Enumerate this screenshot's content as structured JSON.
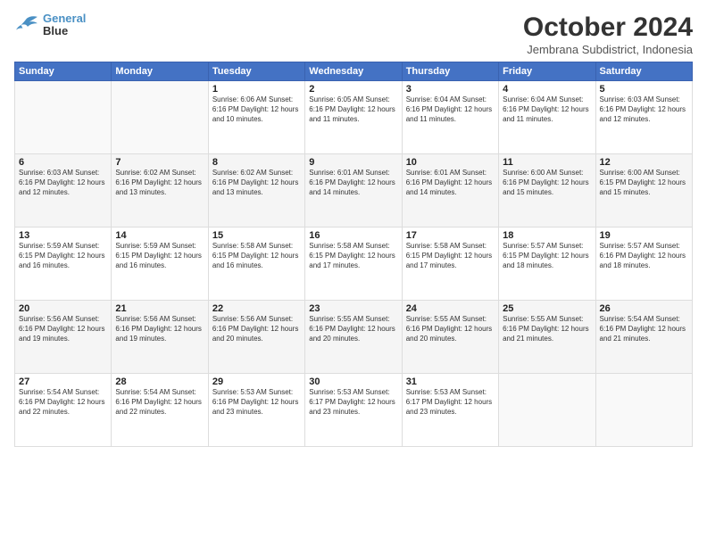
{
  "logo": {
    "line1": "General",
    "line2": "Blue"
  },
  "title": "October 2024",
  "subtitle": "Jembrana Subdistrict, Indonesia",
  "days_of_week": [
    "Sunday",
    "Monday",
    "Tuesday",
    "Wednesday",
    "Thursday",
    "Friday",
    "Saturday"
  ],
  "weeks": [
    [
      {
        "day": "",
        "info": ""
      },
      {
        "day": "",
        "info": ""
      },
      {
        "day": "1",
        "info": "Sunrise: 6:06 AM\nSunset: 6:16 PM\nDaylight: 12 hours\nand 10 minutes."
      },
      {
        "day": "2",
        "info": "Sunrise: 6:05 AM\nSunset: 6:16 PM\nDaylight: 12 hours\nand 11 minutes."
      },
      {
        "day": "3",
        "info": "Sunrise: 6:04 AM\nSunset: 6:16 PM\nDaylight: 12 hours\nand 11 minutes."
      },
      {
        "day": "4",
        "info": "Sunrise: 6:04 AM\nSunset: 6:16 PM\nDaylight: 12 hours\nand 11 minutes."
      },
      {
        "day": "5",
        "info": "Sunrise: 6:03 AM\nSunset: 6:16 PM\nDaylight: 12 hours\nand 12 minutes."
      }
    ],
    [
      {
        "day": "6",
        "info": "Sunrise: 6:03 AM\nSunset: 6:16 PM\nDaylight: 12 hours\nand 12 minutes."
      },
      {
        "day": "7",
        "info": "Sunrise: 6:02 AM\nSunset: 6:16 PM\nDaylight: 12 hours\nand 13 minutes."
      },
      {
        "day": "8",
        "info": "Sunrise: 6:02 AM\nSunset: 6:16 PM\nDaylight: 12 hours\nand 13 minutes."
      },
      {
        "day": "9",
        "info": "Sunrise: 6:01 AM\nSunset: 6:16 PM\nDaylight: 12 hours\nand 14 minutes."
      },
      {
        "day": "10",
        "info": "Sunrise: 6:01 AM\nSunset: 6:16 PM\nDaylight: 12 hours\nand 14 minutes."
      },
      {
        "day": "11",
        "info": "Sunrise: 6:00 AM\nSunset: 6:16 PM\nDaylight: 12 hours\nand 15 minutes."
      },
      {
        "day": "12",
        "info": "Sunrise: 6:00 AM\nSunset: 6:15 PM\nDaylight: 12 hours\nand 15 minutes."
      }
    ],
    [
      {
        "day": "13",
        "info": "Sunrise: 5:59 AM\nSunset: 6:15 PM\nDaylight: 12 hours\nand 16 minutes."
      },
      {
        "day": "14",
        "info": "Sunrise: 5:59 AM\nSunset: 6:15 PM\nDaylight: 12 hours\nand 16 minutes."
      },
      {
        "day": "15",
        "info": "Sunrise: 5:58 AM\nSunset: 6:15 PM\nDaylight: 12 hours\nand 16 minutes."
      },
      {
        "day": "16",
        "info": "Sunrise: 5:58 AM\nSunset: 6:15 PM\nDaylight: 12 hours\nand 17 minutes."
      },
      {
        "day": "17",
        "info": "Sunrise: 5:58 AM\nSunset: 6:15 PM\nDaylight: 12 hours\nand 17 minutes."
      },
      {
        "day": "18",
        "info": "Sunrise: 5:57 AM\nSunset: 6:15 PM\nDaylight: 12 hours\nand 18 minutes."
      },
      {
        "day": "19",
        "info": "Sunrise: 5:57 AM\nSunset: 6:16 PM\nDaylight: 12 hours\nand 18 minutes."
      }
    ],
    [
      {
        "day": "20",
        "info": "Sunrise: 5:56 AM\nSunset: 6:16 PM\nDaylight: 12 hours\nand 19 minutes."
      },
      {
        "day": "21",
        "info": "Sunrise: 5:56 AM\nSunset: 6:16 PM\nDaylight: 12 hours\nand 19 minutes."
      },
      {
        "day": "22",
        "info": "Sunrise: 5:56 AM\nSunset: 6:16 PM\nDaylight: 12 hours\nand 20 minutes."
      },
      {
        "day": "23",
        "info": "Sunrise: 5:55 AM\nSunset: 6:16 PM\nDaylight: 12 hours\nand 20 minutes."
      },
      {
        "day": "24",
        "info": "Sunrise: 5:55 AM\nSunset: 6:16 PM\nDaylight: 12 hours\nand 20 minutes."
      },
      {
        "day": "25",
        "info": "Sunrise: 5:55 AM\nSunset: 6:16 PM\nDaylight: 12 hours\nand 21 minutes."
      },
      {
        "day": "26",
        "info": "Sunrise: 5:54 AM\nSunset: 6:16 PM\nDaylight: 12 hours\nand 21 minutes."
      }
    ],
    [
      {
        "day": "27",
        "info": "Sunrise: 5:54 AM\nSunset: 6:16 PM\nDaylight: 12 hours\nand 22 minutes."
      },
      {
        "day": "28",
        "info": "Sunrise: 5:54 AM\nSunset: 6:16 PM\nDaylight: 12 hours\nand 22 minutes."
      },
      {
        "day": "29",
        "info": "Sunrise: 5:53 AM\nSunset: 6:16 PM\nDaylight: 12 hours\nand 23 minutes."
      },
      {
        "day": "30",
        "info": "Sunrise: 5:53 AM\nSunset: 6:17 PM\nDaylight: 12 hours\nand 23 minutes."
      },
      {
        "day": "31",
        "info": "Sunrise: 5:53 AM\nSunset: 6:17 PM\nDaylight: 12 hours\nand 23 minutes."
      },
      {
        "day": "",
        "info": ""
      },
      {
        "day": "",
        "info": ""
      }
    ]
  ]
}
